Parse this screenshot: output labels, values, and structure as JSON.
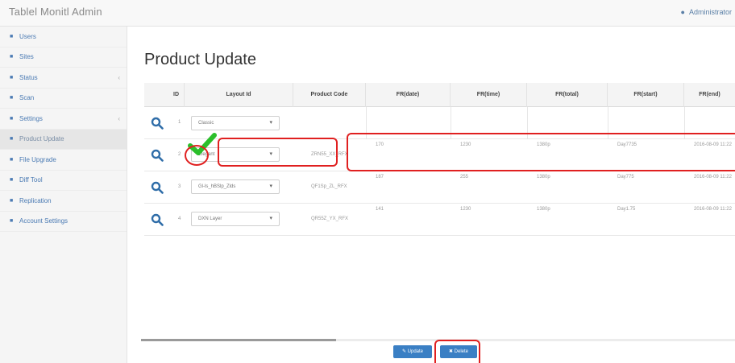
{
  "app": {
    "brand": "Tablel Monitl Admin",
    "user": "Administrator"
  },
  "sidebar": {
    "items": [
      {
        "label": "Users",
        "icon": "users-icon"
      },
      {
        "label": "Sites",
        "icon": "sites-icon"
      },
      {
        "label": "Status",
        "icon": "status-icon",
        "caret": "‹"
      },
      {
        "label": "Scan",
        "icon": "scan-icon"
      },
      {
        "label": "Settings",
        "icon": "settings-icon",
        "caret": "‹"
      },
      {
        "label": "Product Update",
        "icon": "product-update-icon",
        "active": true
      },
      {
        "label": "File Upgrade",
        "icon": "file-upgrade-icon"
      },
      {
        "label": "Diff Tool",
        "icon": "diff-tool-icon"
      },
      {
        "label": "Replication",
        "icon": "replication-icon"
      },
      {
        "label": "Account Settings",
        "icon": "account-settings-icon"
      }
    ]
  },
  "main": {
    "title": "Product Update",
    "columns": [
      "ID",
      "Layout Id",
      "Product Code",
      "FR(date)",
      "FR(time)",
      "FR(total)",
      "FR(start)",
      "FR(end)"
    ],
    "rows": [
      {
        "id": "1",
        "layout": "Classic",
        "code": "",
        "c1": "",
        "c2": "",
        "c3": "",
        "c4": "",
        "c5": ""
      },
      {
        "id": "2",
        "layout": "Elegant",
        "code": "ZRN55_XX_RFX",
        "c1": "170",
        "c2": "1230",
        "c3": "1380p",
        "c4": "Day7735",
        "c5": "2016-08-09 11:22"
      },
      {
        "id": "3",
        "layout": "Gl-ls_hBSlp_Zlds",
        "code": "QF1Sp_ZL_RFX",
        "c1": "187",
        "c2": "255",
        "c3": "1380p",
        "c4": "Day775",
        "c5": "2016-08-09 11:22"
      },
      {
        "id": "4",
        "layout": "DXN Layer",
        "code": "QR55Z_YX_RFX",
        "c1": "141",
        "c2": "1230",
        "c3": "1380p",
        "c4": "Day1.75",
        "c5": "2016-08-09 11:22"
      }
    ]
  },
  "buttons": {
    "update": "Update",
    "delete": "Delete"
  },
  "colors": {
    "accent": "#3a7fc4",
    "annotation": "#e02020",
    "check": "#2bbf2b"
  }
}
